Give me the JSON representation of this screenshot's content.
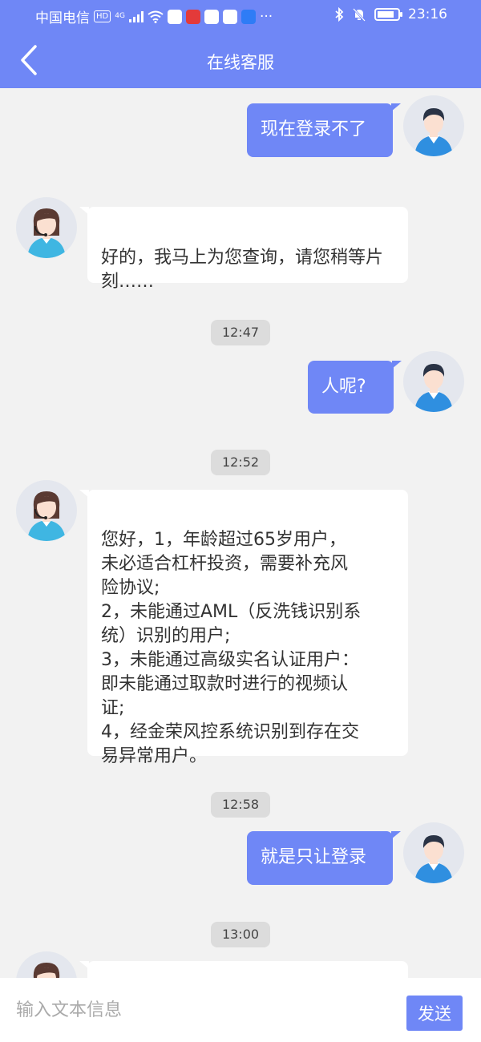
{
  "status_bar": {
    "carrier": "中国电信",
    "hd_badge": "HD",
    "network": "4G",
    "time": "23:16",
    "more": "···"
  },
  "header": {
    "title": "在线客服"
  },
  "messages": [
    {
      "from": "user",
      "text": "现在登录不了"
    },
    {
      "from": "agent",
      "text": "好的，我马上为您查询，请您稍等片刻……"
    },
    {
      "type": "time",
      "text": "12:47"
    },
    {
      "from": "user",
      "text": "人呢?"
    },
    {
      "type": "time",
      "text": "12:52"
    },
    {
      "from": "agent",
      "text": "您好，1，年龄超过65岁用户，\n未必适合杠杆投资，需要补充风\n险协议;\n2，未能通过AML（反洗钱识别系\n统）识别的用户;\n3，未能通过高级实名认证用户：\n即未能通过取款时进行的视频认\n证;\n4，经金荣风控系统识别到存在交\n易异常用户。"
    },
    {
      "type": "time",
      "text": "12:58"
    },
    {
      "from": "user",
      "text": "就是只让登录"
    },
    {
      "type": "time",
      "text": "13:00"
    },
    {
      "from": "agent",
      "text": ""
    }
  ],
  "composer": {
    "placeholder": "输入文本信息",
    "send_label": "发送"
  },
  "colors": {
    "accent": "#6f87f6",
    "background": "#f2f2f2",
    "agent_bubble": "#ffffff"
  }
}
